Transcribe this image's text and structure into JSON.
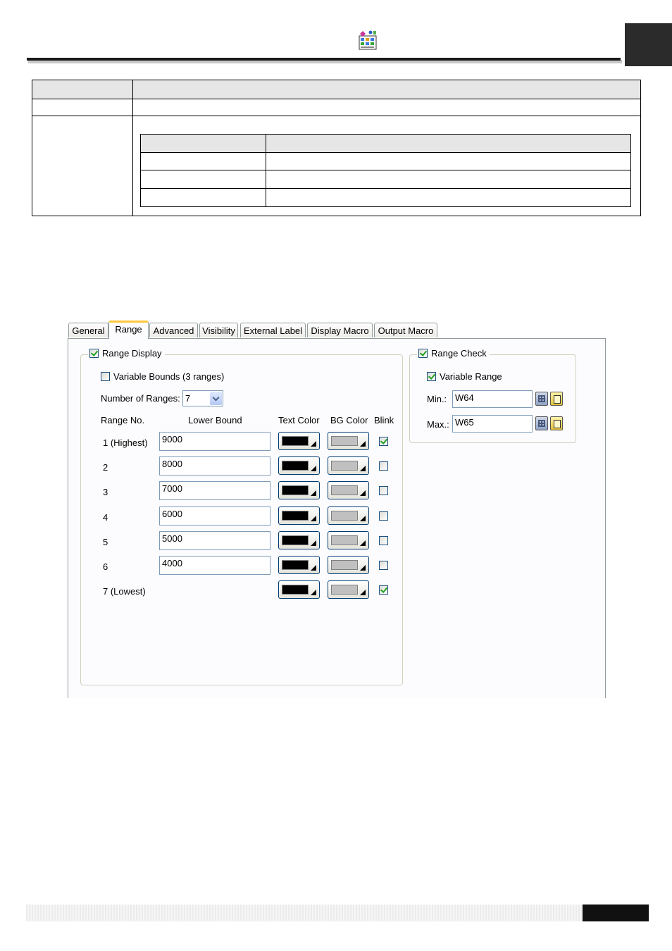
{
  "page_header": {
    "icon": "table-grid-icon"
  },
  "dialog": {
    "tabs": [
      {
        "label": "General"
      },
      {
        "label": "Range",
        "active": true
      },
      {
        "label": "Advanced"
      },
      {
        "label": "Visibility"
      },
      {
        "label": "External Label"
      },
      {
        "label": "Display Macro"
      },
      {
        "label": "Output Macro"
      }
    ],
    "range_display": {
      "label": "Range Display",
      "checked": true,
      "variable_bounds": {
        "label": "Variable Bounds (3 ranges)",
        "checked": false
      },
      "number_of_ranges": {
        "label": "Number of Ranges:",
        "value": "7"
      },
      "headers": {
        "range_no": "Range No.",
        "lower_bound": "Lower Bound",
        "text_color": "Text Color",
        "bg_color": "BG Color",
        "blink": "Blink"
      },
      "rows": [
        {
          "no": "1 (Highest)",
          "lower_bound": "9000",
          "text_color": "#000000",
          "bg_color": "#c0c0c0",
          "blink": true
        },
        {
          "no": "2",
          "lower_bound": "8000",
          "text_color": "#000000",
          "bg_color": "#c0c0c0",
          "blink": false
        },
        {
          "no": "3",
          "lower_bound": "7000",
          "text_color": "#000000",
          "bg_color": "#c0c0c0",
          "blink": false
        },
        {
          "no": "4",
          "lower_bound": "6000",
          "text_color": "#000000",
          "bg_color": "#c0c0c0",
          "blink": false
        },
        {
          "no": "5",
          "lower_bound": "5000",
          "text_color": "#000000",
          "bg_color": "#c0c0c0",
          "blink": false
        },
        {
          "no": "6",
          "lower_bound": "4000",
          "text_color": "#000000",
          "bg_color": "#c0c0c0",
          "blink": false
        },
        {
          "no": "7 (Lowest)",
          "lower_bound": null,
          "text_color": "#000000",
          "bg_color": "#c0c0c0",
          "blink": true
        }
      ]
    },
    "range_check": {
      "label": "Range Check",
      "checked": true,
      "variable_range": {
        "label": "Variable Range",
        "checked": true
      },
      "min": {
        "label": "Min.:",
        "value": "W64"
      },
      "max": {
        "label": "Max.:",
        "value": "W65"
      }
    }
  },
  "colors": {
    "tab_highlight": "#ffc83c",
    "panel_bg": "#fcfcfe",
    "checkmark": "#21a121"
  }
}
